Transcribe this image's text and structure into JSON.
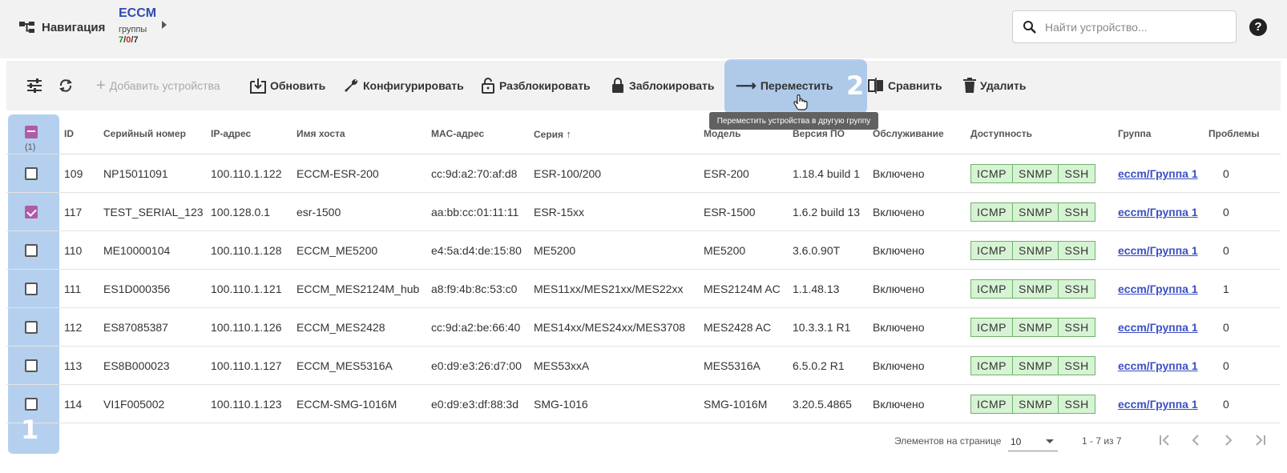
{
  "header": {
    "nav_label": "Навигация",
    "brand_title": "ECCM",
    "brand_subtitle": "группы",
    "counts": {
      "a": "7",
      "sep1": "/",
      "b": "0",
      "sep2": "/",
      "c": "7"
    },
    "search_placeholder": "Найти устройство...",
    "help_label": "?"
  },
  "toolbar": {
    "add_label": "Добавить устройства",
    "refresh_label": "Обновить",
    "configure_label": "Конфигурировать",
    "unlock_label": "Разблокировать",
    "lock_label": "Заблокировать",
    "move_label": "Переместить",
    "compare_label": "Сравнить",
    "delete_label": "Удалить"
  },
  "tutorial": {
    "step1": "1",
    "step2": "2",
    "tooltip": "Переместить устройства в другую группу"
  },
  "table": {
    "selected_count": "(1)",
    "columns": {
      "id": "ID",
      "serial": "Серийный номер",
      "ip": "IP-адрес",
      "hostname": "Имя хоста",
      "mac": "MAC-адрес",
      "series": "Серия",
      "model": "Модель",
      "fw": "Версия ПО",
      "service": "Обслуживание",
      "access": "Доступность",
      "group": "Группа",
      "problems": "Проблемы"
    },
    "rows": [
      {
        "checked": false,
        "id": "109",
        "serial": "NP15011091",
        "ip": "100.110.1.122",
        "hostname": "ECCM-ESR-200",
        "mac": "cc:9d:a2:70:af:d8",
        "series": "ESR-100/200",
        "model": "ESR-200",
        "fw": "1.18.4 build 1",
        "service": "Включено",
        "access": [
          "ICMP",
          "SNMP",
          "SSH"
        ],
        "group": "eccm/Группа 1",
        "problems": "0"
      },
      {
        "checked": true,
        "id": "117",
        "serial": "TEST_SERIAL_123",
        "ip": "100.128.0.1",
        "hostname": "esr-1500",
        "mac": "aa:bb:cc:01:11:11",
        "series": "ESR-15xx",
        "model": "ESR-1500",
        "fw": "1.6.2 build 13",
        "service": "Включено",
        "access": [
          "ICMP",
          "SNMP",
          "SSH"
        ],
        "group": "eccm/Группа 1",
        "problems": "0"
      },
      {
        "checked": false,
        "id": "110",
        "serial": "ME10000104",
        "ip": "100.110.1.128",
        "hostname": "ECCM_ME5200",
        "mac": "e4:5a:d4:de:15:80",
        "series": "ME5200",
        "model": "ME5200",
        "fw": "3.6.0.90T",
        "service": "Включено",
        "access": [
          "ICMP",
          "SNMP",
          "SSH"
        ],
        "group": "eccm/Группа 1",
        "problems": "0"
      },
      {
        "checked": false,
        "id": "111",
        "serial": "ES1D000356",
        "ip": "100.110.1.121",
        "hostname": "ECCM_MES2124M_hub",
        "mac": "a8:f9:4b:8c:53:c0",
        "series": "MES11xx/MES21xx/MES22xx",
        "model": "MES2124M AC",
        "fw": "1.1.48.13",
        "service": "Включено",
        "access": [
          "ICMP",
          "SNMP",
          "SSH"
        ],
        "group": "eccm/Группа 1",
        "problems": "1"
      },
      {
        "checked": false,
        "id": "112",
        "serial": "ES87085387",
        "ip": "100.110.1.126",
        "hostname": "ECCM_MES2428",
        "mac": "cc:9d:a2:be:66:40",
        "series": "MES14xx/MES24xx/MES3708",
        "model": "MES2428 AC",
        "fw": "10.3.3.1 R1",
        "service": "Включено",
        "access": [
          "ICMP",
          "SNMP",
          "SSH"
        ],
        "group": "eccm/Группа 1",
        "problems": "0"
      },
      {
        "checked": false,
        "id": "113",
        "serial": "ES8B000023",
        "ip": "100.110.1.127",
        "hostname": "ECCM_MES5316A",
        "mac": "e0:d9:e3:26:d7:00",
        "series": "MES53xxA",
        "model": "MES5316A",
        "fw": "6.5.0.2 R1",
        "service": "Включено",
        "access": [
          "ICMP",
          "SNMP",
          "SSH"
        ],
        "group": "eccm/Группа 1",
        "problems": "0"
      },
      {
        "checked": false,
        "id": "114",
        "serial": "VI1F005002",
        "ip": "100.110.1.123",
        "hostname": "ECCM-SMG-1016M",
        "mac": "e0:d9:e3:df:88:3d",
        "series": "SMG-1016",
        "model": "SMG-1016M",
        "fw": "3.20.5.4865",
        "service": "Включено",
        "access": [
          "ICMP",
          "SNMP",
          "SSH"
        ],
        "group": "eccm/Группа 1",
        "problems": "0"
      }
    ]
  },
  "footer": {
    "per_page_label": "Элементов на странице",
    "per_page_value": "10",
    "range": "1 - 7 из 7"
  },
  "colors": {
    "accent": "#2e4bb3",
    "checkbox": "#b05aa8",
    "chip_bg": "#d6f3d3",
    "highlight": "#78aae1"
  }
}
